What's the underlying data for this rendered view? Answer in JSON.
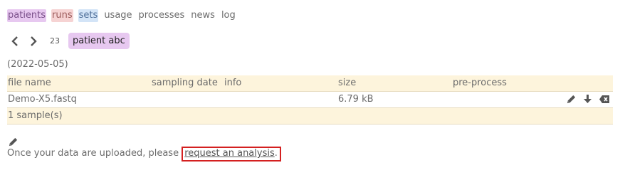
{
  "nav": {
    "patients": "patients",
    "runs": "runs",
    "sets": "sets",
    "usage": "usage",
    "processes": "processes",
    "news": "news",
    "log": "log"
  },
  "pager": {
    "count": "23",
    "patient_label": "patient abc"
  },
  "patient": {
    "date": "(2022-05-05)"
  },
  "table": {
    "columns": [
      "file name",
      "sampling date",
      "info",
      "size",
      "pre-process"
    ],
    "rows": [
      {
        "file_name": "Demo-X5.fastq",
        "sampling_date": "",
        "info": "",
        "size": "6.79 kB",
        "preprocess": ""
      }
    ],
    "footer": "1 sample(s)"
  },
  "bottom": {
    "text": "Once your data are uploaded, please ",
    "link": "request an analysis",
    "suffix": "."
  },
  "icons": {
    "prev": "chevron-left-icon",
    "next": "chevron-right-icon",
    "edit": "pencil-icon",
    "download": "download-icon",
    "delete": "delete-icon"
  },
  "colors": {
    "patients_bg": "#e7c8f0",
    "runs_bg": "#f6d3d3",
    "sets_bg": "#d3e4f7",
    "table_header_bg": "#fdf4dc",
    "highlight_border": "#d42020"
  }
}
